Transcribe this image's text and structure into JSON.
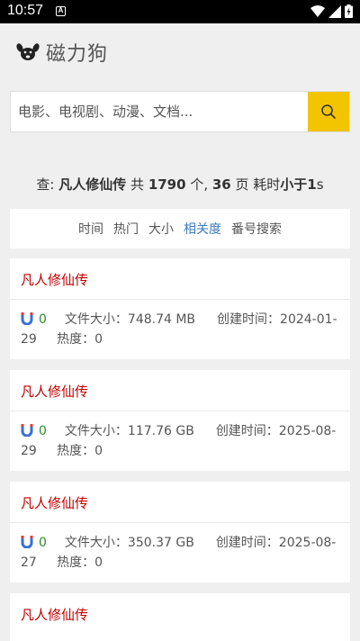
{
  "status_bar": {
    "time": "10:57",
    "notif_icon": "A"
  },
  "header": {
    "logo_icon": "dog-paw-icon",
    "app_name": "磁力狗"
  },
  "search": {
    "placeholder": "电影、电视剧、动漫、文档...",
    "value": "",
    "button_icon": "search-icon",
    "button_color": "#f3c400"
  },
  "summary": {
    "prefix": "查: ",
    "query": "凡人修仙传",
    "total_prefix": " 共 ",
    "total": "1790",
    "total_suffix": " 个, ",
    "pages": "36",
    "pages_suffix": " 页 耗时",
    "time": "小于1",
    "time_unit": "s"
  },
  "sort": {
    "items": [
      {
        "label": "时间",
        "active": false
      },
      {
        "label": "热门",
        "active": false
      },
      {
        "label": "大小",
        "active": false
      },
      {
        "label": "相关度",
        "active": true
      },
      {
        "label": "番号搜索",
        "active": false
      }
    ],
    "active_color": "#3a7ac0"
  },
  "results": [
    {
      "title": "凡人修仙传",
      "seeds": "0",
      "size_label": "文件大小：748.74 MB",
      "created_label": "创建时间：2024-01-29",
      "heat_label": "热度：0"
    },
    {
      "title": "凡人修仙传",
      "seeds": "0",
      "size_label": "文件大小：117.76 GB",
      "created_label": "创建时间：2025-08-29",
      "heat_label": "热度：0"
    },
    {
      "title": "凡人修仙传",
      "seeds": "0",
      "size_label": "文件大小：350.37 GB",
      "created_label": "创建时间：2025-08-27",
      "heat_label": "热度：0"
    },
    {
      "title": "凡人修仙传"
    }
  ],
  "colors": {
    "title_red": "#c40000",
    "seed_green": "#2e8b2e"
  }
}
